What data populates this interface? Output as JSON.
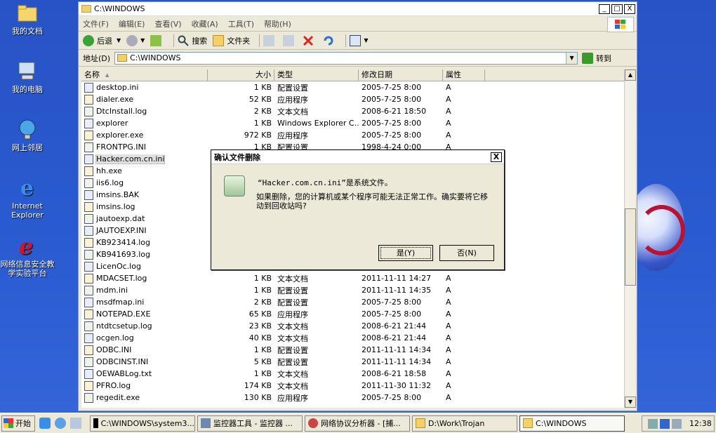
{
  "desktop": {
    "icons": [
      {
        "label": "我的文档"
      },
      {
        "label": "我的电脑"
      },
      {
        "label": "网上邻居"
      },
      {
        "label": "Internet Explorer"
      },
      {
        "label": "网络信息安全教学实验平台"
      }
    ]
  },
  "window": {
    "title": "C:\\WINDOWS",
    "controls": {
      "minimize": "_",
      "maximize": "□",
      "close": "X"
    },
    "menu": [
      "文件(F)",
      "编辑(E)",
      "查看(V)",
      "收藏(A)",
      "工具(T)",
      "帮助(H)"
    ],
    "toolbar": {
      "back": "后退",
      "search": "搜索",
      "folders": "文件夹"
    },
    "address": {
      "label": "地址(D)",
      "value": "C:\\WINDOWS",
      "go": "转到"
    },
    "columns": {
      "name": "名称",
      "size": "大小",
      "type": "类型",
      "modified": "修改日期",
      "attr": "属性"
    },
    "files": [
      {
        "name": "desktop.ini",
        "size": "1 KB",
        "type": "配置设置",
        "modified": "2005-7-25 8:00",
        "attr": "A"
      },
      {
        "name": "dialer.exe",
        "size": "52 KB",
        "type": "应用程序",
        "modified": "2005-7-25 8:00",
        "attr": "A"
      },
      {
        "name": "DtcInstall.log",
        "size": "2 KB",
        "type": "文本文档",
        "modified": "2008-6-21 18:50",
        "attr": "A"
      },
      {
        "name": "explorer",
        "size": "1 KB",
        "type": "Windows Explorer C...",
        "modified": "2005-7-25 8:00",
        "attr": "A"
      },
      {
        "name": "explorer.exe",
        "size": "972 KB",
        "type": "应用程序",
        "modified": "2005-7-25 8:00",
        "attr": "A"
      },
      {
        "name": "FRONTPG.INI",
        "size": "1 KB",
        "type": "配置设置",
        "modified": "1998-4-24 0:00",
        "attr": "A"
      },
      {
        "name": "Hacker.com.cn.ini",
        "size": "",
        "type": "",
        "modified": "",
        "attr": ""
      },
      {
        "name": "hh.exe",
        "size": "",
        "type": "",
        "modified": "",
        "attr": ""
      },
      {
        "name": "iis6.log",
        "size": "",
        "type": "",
        "modified": "",
        "attr": ""
      },
      {
        "name": "imsins.BAK",
        "size": "",
        "type": "",
        "modified": "",
        "attr": ""
      },
      {
        "name": "imsins.log",
        "size": "",
        "type": "",
        "modified": "",
        "attr": ""
      },
      {
        "name": "jautoexp.dat",
        "size": "",
        "type": "",
        "modified": "",
        "attr": ""
      },
      {
        "name": "JAUTOEXP.INI",
        "size": "",
        "type": "",
        "modified": "",
        "attr": ""
      },
      {
        "name": "KB923414.log",
        "size": "",
        "type": "",
        "modified": "",
        "attr": ""
      },
      {
        "name": "KB941693.log",
        "size": "",
        "type": "",
        "modified": "",
        "attr": ""
      },
      {
        "name": "LicenOc.log",
        "size": "",
        "type": "",
        "modified": "",
        "attr": ""
      },
      {
        "name": "MDACSET.log",
        "size": "1 KB",
        "type": "文本文档",
        "modified": "2011-11-11 14:27",
        "attr": "A"
      },
      {
        "name": "mdm.ini",
        "size": "1 KB",
        "type": "配置设置",
        "modified": "2011-11-11 14:35",
        "attr": "A"
      },
      {
        "name": "msdfmap.ini",
        "size": "2 KB",
        "type": "配置设置",
        "modified": "2005-7-25 8:00",
        "attr": "A"
      },
      {
        "name": "NOTEPAD.EXE",
        "size": "65 KB",
        "type": "应用程序",
        "modified": "2005-7-25 8:00",
        "attr": "A"
      },
      {
        "name": "ntdtcsetup.log",
        "size": "23 KB",
        "type": "文本文档",
        "modified": "2008-6-21 21:44",
        "attr": "A"
      },
      {
        "name": "ocgen.log",
        "size": "40 KB",
        "type": "文本文档",
        "modified": "2008-6-21 21:44",
        "attr": "A"
      },
      {
        "name": "ODBC.INI",
        "size": "1 KB",
        "type": "配置设置",
        "modified": "2011-11-11 14:34",
        "attr": "A"
      },
      {
        "name": "ODBCINST.INI",
        "size": "5 KB",
        "type": "配置设置",
        "modified": "2011-11-11 14:34",
        "attr": "A"
      },
      {
        "name": "OEWABLog.txt",
        "size": "1 KB",
        "type": "文本文档",
        "modified": "2008-6-21 18:58",
        "attr": "A"
      },
      {
        "name": "PFRO.log",
        "size": "174 KB",
        "type": "文本文档",
        "modified": "2011-11-30 11:32",
        "attr": "A"
      },
      {
        "name": "regedit.exe",
        "size": "130 KB",
        "type": "应用程序",
        "modified": "2005-7-25 8:00",
        "attr": "A"
      }
    ]
  },
  "dialog": {
    "title": "确认文件删除",
    "close": "X",
    "message1": "“Hacker.com.cn.ini”是系统文件。",
    "message2": "如果删除，您的计算机或某个程序可能无法正常工作。确实要将它移动到回收站吗?",
    "yes": "是(Y)",
    "no": "否(N)"
  },
  "taskbar": {
    "start": "开始",
    "tasks": [
      "C:\\WINDOWS\\system3...",
      "监控器工具 - 监控器 ...",
      "网络协议分析器 - [捕...",
      "D:\\Work\\Trojan",
      "C:\\WINDOWS"
    ],
    "clock": "12:38"
  }
}
